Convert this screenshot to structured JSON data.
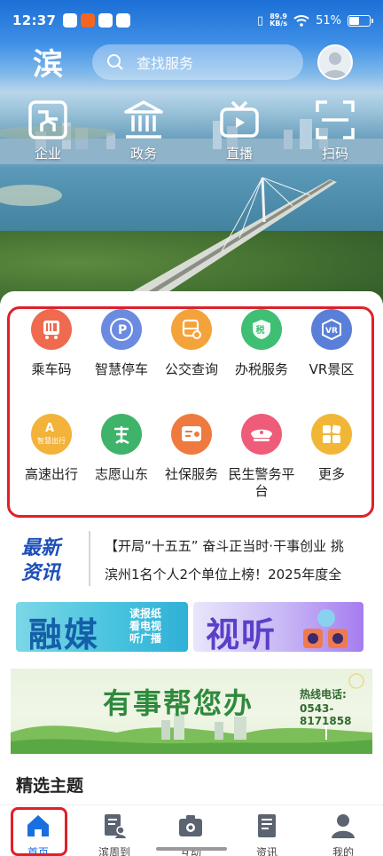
{
  "status_bar": {
    "time": "12:37",
    "net_speed": "89.9",
    "net_unit": "KB/s",
    "battery": "51%",
    "battery_level": 0.51
  },
  "header": {
    "logo_text": "滨",
    "search_placeholder": "查找服务"
  },
  "quick_nav": [
    {
      "label": "企业",
      "icon": "enterprise-icon"
    },
    {
      "label": "政务",
      "icon": "government-icon"
    },
    {
      "label": "直播",
      "icon": "tv-icon"
    },
    {
      "label": "扫码",
      "icon": "scan-icon"
    }
  ],
  "services": [
    {
      "label": "乘车码",
      "icon": "bus-code-icon",
      "color": "#ef6a4f"
    },
    {
      "label": "智慧停车",
      "icon": "parking-icon",
      "color": "#6b8be0"
    },
    {
      "label": "公交查询",
      "icon": "bus-search-icon",
      "color": "#f4a23a"
    },
    {
      "label": "办税服务",
      "icon": "tax-icon",
      "color": "#3fbf74"
    },
    {
      "label": "VR景区",
      "icon": "vr-icon",
      "color": "#5a7fd8"
    },
    {
      "label": "高速出行",
      "icon": "highway-icon",
      "color": "#f3b23a",
      "inner_text": "智慧出行"
    },
    {
      "label": "志愿山东",
      "icon": "volunteer-icon",
      "color": "#3fb36a"
    },
    {
      "label": "社保服务",
      "icon": "social-security-icon",
      "color": "#ef7a3f"
    },
    {
      "label": "民生警务平台",
      "icon": "police-icon",
      "color": "#ee5c7a"
    },
    {
      "label": "更多",
      "icon": "more-icon",
      "color": "#f2b636"
    }
  ],
  "news": {
    "logo_line1": "最新",
    "logo_line2": "资讯",
    "items": [
      "【开局“十五五” 奋斗正当时·干事创业 挑",
      "滨州1名个人2个单位上榜！2025年度全"
    ]
  },
  "banners": {
    "rongmei": {
      "title": "融媒",
      "side": [
        "读报纸",
        "看电视",
        "听广播"
      ]
    },
    "shiting": {
      "title": "视听"
    },
    "help": {
      "title": "有事帮您办",
      "hotline_label": "热线电话:",
      "hotline_number": "0543-8171858"
    }
  },
  "section_title": "精选主题",
  "bottom_nav": [
    {
      "label": "首页",
      "icon": "home-icon",
      "active": true
    },
    {
      "label": "滨周到",
      "icon": "service-icon",
      "active": false
    },
    {
      "label": "互动",
      "icon": "camera-icon",
      "active": false
    },
    {
      "label": "资讯",
      "icon": "news-icon",
      "active": false
    },
    {
      "label": "我的",
      "icon": "profile-icon",
      "active": false
    }
  ],
  "colors": {
    "accent": "#1a6fe0",
    "highlight_frame": "#e0202a"
  }
}
